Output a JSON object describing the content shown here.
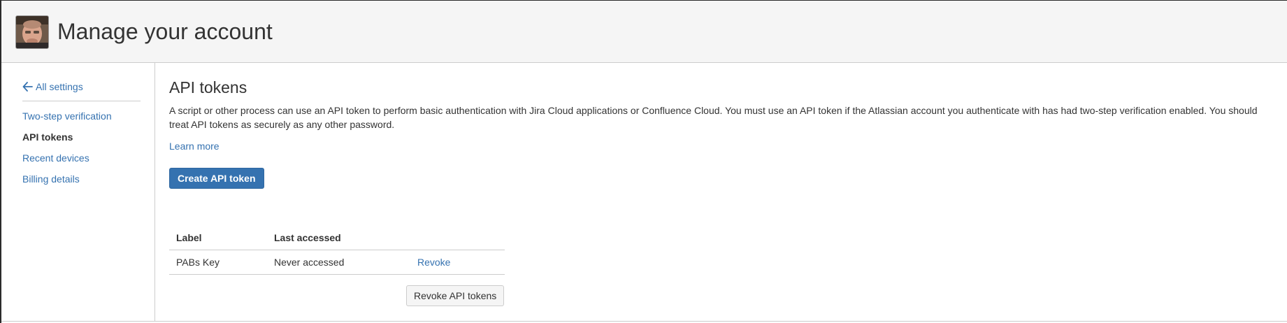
{
  "header": {
    "title": "Manage your account",
    "avatar_icon": "user-avatar"
  },
  "sidebar": {
    "back_label": "All settings",
    "back_icon": "arrow-left-icon",
    "items": [
      {
        "label": "Two-step verification",
        "active": false
      },
      {
        "label": "API tokens",
        "active": true
      },
      {
        "label": "Recent devices",
        "active": false
      },
      {
        "label": "Billing details",
        "active": false
      }
    ]
  },
  "main": {
    "title": "API tokens",
    "description": "A script or other process can use an API token to perform basic authentication with Jira Cloud applications or Confluence Cloud. You must use an API token if the Atlassian account you authenticate with has had two-step verification enabled. You should treat API tokens as securely as any other password.",
    "learn_more": "Learn more",
    "create_button": "Create API token",
    "table": {
      "headers": [
        "Label",
        "Last accessed",
        ""
      ],
      "rows": [
        {
          "label": "PABs Key",
          "last_accessed": "Never accessed",
          "action": "Revoke"
        }
      ]
    },
    "revoke_all_button": "Revoke API tokens"
  },
  "colors": {
    "link": "#3572b0",
    "primary_button": "#3572b0",
    "header_bg": "#f5f5f5",
    "text": "#333333"
  }
}
